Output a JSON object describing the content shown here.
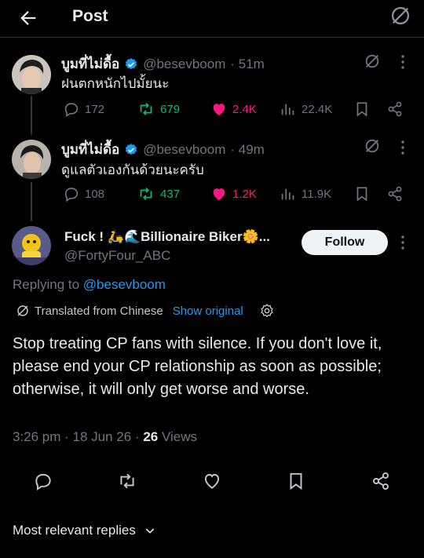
{
  "header": {
    "title": "Post"
  },
  "colors": {
    "accent": "#1d9bf0",
    "retweet": "#00ba7c",
    "like": "#f91880",
    "muted": "#71767b"
  },
  "tweets": [
    {
      "display_name": "บูมที่ไม่ดื้อ",
      "handle": "@besevboom",
      "time": "· 51m",
      "text": "ฝนตกหนักไปมั้ยนะ",
      "replies": "172",
      "retweets": "679",
      "likes": "2.4K",
      "views": "22.4K"
    },
    {
      "display_name": "บูมที่ไม่ดื้อ",
      "handle": "@besevboom",
      "time": "· 49m",
      "text": "ดูแลตัวเองกันด้วยนะครับ",
      "replies": "108",
      "retweets": "437",
      "likes": "1.2K",
      "views": "11.9K"
    }
  ],
  "main_post": {
    "display_name": "Fuck !  🛵🌊Billionaire Biker🌼...",
    "handle": "@FortyFour_ABC",
    "follow_label": "Follow",
    "replying_prefix": "Replying to ",
    "replying_to": "@besevboom",
    "translated_label": "Translated from Chinese",
    "show_original": "Show original",
    "text": "Stop treating CP fans with silence. If you don't love it, please end your CP relationship as soon as possible; otherwise, it will only get worse and worse.",
    "timestamp": "3:26 pm · 18 Jun 26 · ",
    "views_count": "26",
    "views_label": " Views"
  },
  "replies_sort": {
    "label": "Most relevant replies"
  }
}
